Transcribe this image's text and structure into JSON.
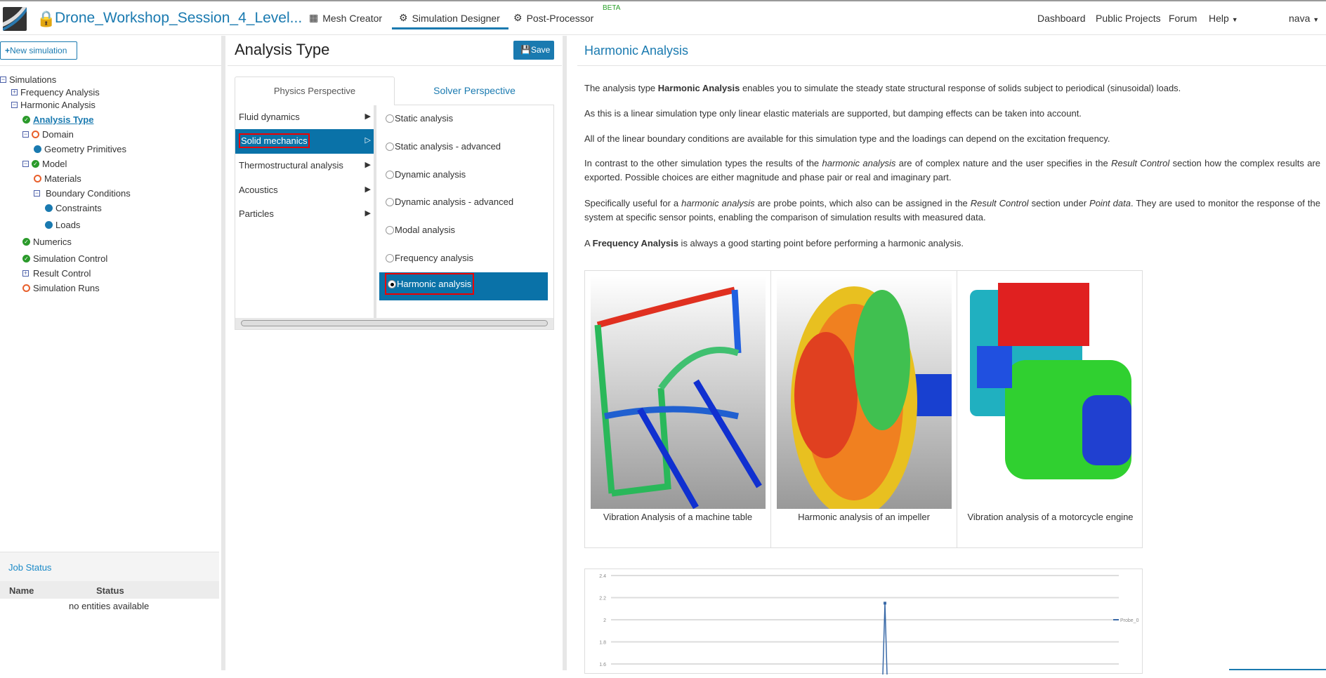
{
  "header": {
    "project_title": "Drone_Workshop_Session_4_Level...",
    "nav": [
      {
        "label": "Mesh Creator",
        "icon": "grid-icon"
      },
      {
        "label": "Simulation Designer",
        "icon": "gears-icon"
      },
      {
        "label": "Post-Processor",
        "icon": "gear-icon"
      }
    ],
    "beta": "BETA",
    "right_nav": [
      "Dashboard",
      "Public Projects",
      "Forum",
      "Help"
    ],
    "user": "nava"
  },
  "left": {
    "new_sim": "New simulation",
    "tree": [
      "Simulations",
      "Frequency Analysis",
      "Harmonic Analysis",
      "Analysis Type",
      "Domain",
      "Geometry Primitives",
      "Model",
      "Materials",
      "Boundary Conditions",
      "Constraints",
      "Loads",
      "Numerics",
      "Simulation Control",
      "Result Control",
      "Simulation Runs"
    ],
    "job_status": "Job Status",
    "job_cols": [
      "Name",
      "Status"
    ],
    "job_empty": "no entities available"
  },
  "mid": {
    "title": "Analysis Type",
    "save": "Save",
    "tabs": [
      "Physics Perspective",
      "Solver Perspective"
    ],
    "categories": [
      "Fluid dynamics",
      "Solid mechanics",
      "Thermostructural analysis",
      "Acoustics",
      "Particles"
    ],
    "options": [
      "Static analysis",
      "Static analysis - advanced",
      "Dynamic analysis",
      "Dynamic analysis - advanced",
      "Modal analysis",
      "Frequency analysis",
      "Harmonic analysis"
    ],
    "selected_category": "Solid mechanics",
    "selected_option": "Harmonic analysis"
  },
  "right": {
    "title": "Harmonic Analysis",
    "p1": {
      "a": "The analysis type ",
      "b": "Harmonic Analysis",
      "c": " enables you to simulate the steady state structural response of solids subject to periodical (sinusoidal) loads."
    },
    "p2": "As this is a linear simulation type only linear elastic materials are supported, but damping effects can be taken into account.",
    "p3": "All of the linear boundary conditions are available for this simulation type and the loadings can depend on the excitation frequency.",
    "p4": {
      "a": "In contrast to the other simulation types the results of the ",
      "b": "harmonic analysis",
      "c": " are of complex nature and the user specifies in the ",
      "d": "Result Control",
      "e": " section how the complex results are exported. Possible choices are either magnitude and phase pair or real and imaginary part."
    },
    "p5": {
      "a": "Specifically useful for a ",
      "b": "harmonic analysis",
      "c": " are probe points, which also can be assigned in the ",
      "d": "Result Control",
      "e": " section under ",
      "f": "Point data",
      "g": ". They are used to monitor the response of the system at specific sensor points, enabling the comparison of simulation results with measured data."
    },
    "p6": {
      "a": "A ",
      "b": "Frequency Analysis",
      "c": " is always a good starting point before performing a harmonic analysis."
    },
    "captions": [
      "Vibration Analysis of a machine table",
      "Harmonic analysis of an impeller",
      "Vibration analysis of a motorcycle engine"
    ]
  },
  "chart_data": {
    "type": "line",
    "yticks": [
      "2.4",
      "2.2",
      "2",
      "1.8",
      "1.6"
    ],
    "ylim": [
      1.5,
      2.4
    ],
    "series": [
      {
        "name": "Probe_0",
        "peak": 2.15
      }
    ],
    "legend": "right"
  },
  "colors": {
    "accent": "#1a7ab0",
    "selected": "#0a72a8",
    "ok": "#2a9a2a",
    "warn": "#e8602c"
  }
}
